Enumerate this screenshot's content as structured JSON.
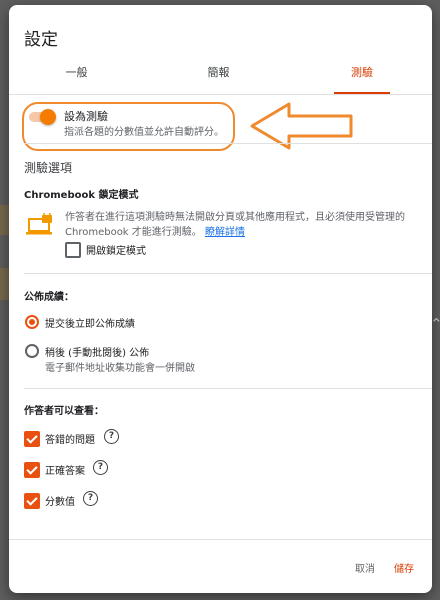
{
  "dialog": {
    "title": "設定"
  },
  "tabs": [
    {
      "label": "一般",
      "active": false
    },
    {
      "label": "簡報",
      "active": false
    },
    {
      "label": "測驗",
      "active": true
    }
  ],
  "quiz_toggle": {
    "on": true,
    "label": "設為測驗",
    "description": "指派各題的分數值並允許自動評分。"
  },
  "quiz_options": {
    "title": "測驗選項",
    "chromebook": {
      "heading": "Chromebook 鎖定模式",
      "description": "作答者在進行這項測驗時無法開啟分頁或其他應用程式，且必須使用受管理的 Chromebook 才能進行測驗。",
      "learn_more": "瞭解詳情",
      "checkbox_label": "開啟鎖定模式",
      "checked": false
    },
    "release_grade": {
      "heading": "公佈成績：",
      "options": [
        {
          "label": "提交後立即公佈成績",
          "selected": true,
          "sub": ""
        },
        {
          "label": "稍後 (手動批閱後) 公佈",
          "selected": false,
          "sub": "電子郵件地址收集功能會一併開啟"
        }
      ]
    },
    "respondent_can_see": {
      "heading": "作答者可以查看：",
      "items": [
        {
          "label": "答錯的問題",
          "checked": true
        },
        {
          "label": "正確答案",
          "checked": true
        },
        {
          "label": "分數值",
          "checked": true
        }
      ]
    }
  },
  "footer": {
    "cancel": "取消",
    "save": "儲存"
  },
  "annotation": {
    "color": "#ef8a2e"
  },
  "colors": {
    "accent": "#d93d04",
    "checkbox": "#e8510f",
    "link": "#1a73e8"
  }
}
